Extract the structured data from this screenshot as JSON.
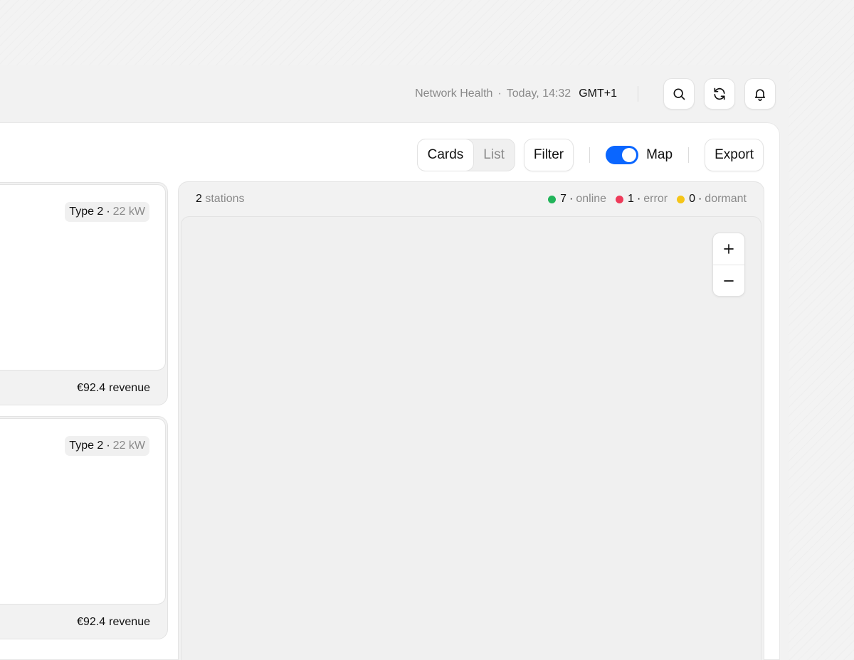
{
  "header": {
    "page_name": "Network Health",
    "separator": "·",
    "time": "Today, 14:32",
    "timezone": "GMT+1",
    "actions": [
      "search-icon",
      "refresh-icon",
      "bell-icon"
    ]
  },
  "toolbar": {
    "view_modes": [
      "Cards",
      "List"
    ],
    "active_view": "Cards",
    "filter_label": "Filter",
    "map_toggle": {
      "label": "Map",
      "on": true
    },
    "export_label": "Export"
  },
  "cards": [
    {
      "connector": "Type 2",
      "power": "22 kW",
      "revenue": "€92.4",
      "revenue_label": "revenue"
    },
    {
      "connector": "Type 2",
      "power": "22 kW",
      "revenue": "€92.4",
      "revenue_label": "revenue"
    }
  ],
  "map": {
    "station_count": "2",
    "station_label": "stations",
    "legend": [
      {
        "count": "7",
        "label": "online",
        "color": "#22b45a"
      },
      {
        "count": "1",
        "label": "error",
        "color": "#ee3b5a"
      },
      {
        "count": "0",
        "label": "dormant",
        "color": "#f5c518"
      }
    ],
    "zoom_in": "+",
    "zoom_out": "−"
  },
  "colors": {
    "accent": "#0a66ff",
    "online": "#22b45a",
    "error": "#ee3b5a",
    "dormant": "#f5c518"
  }
}
